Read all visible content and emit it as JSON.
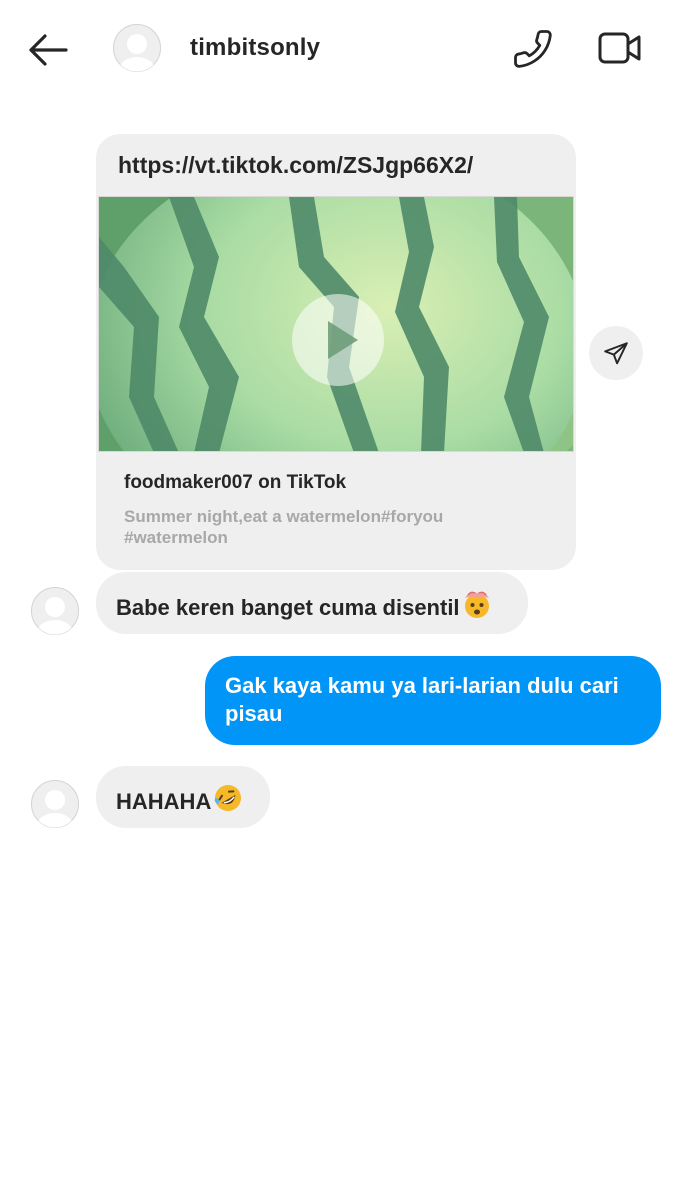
{
  "header": {
    "username": "timbitsonly",
    "icons": {
      "back": "arrow-left-icon",
      "call": "phone-icon",
      "video": "video-camera-icon"
    }
  },
  "share": {
    "url": "https://vt.tiktok.com/ZSJgp66X2/",
    "title": "foodmaker007 on TikTok",
    "description": "Summer night,eat a watermelon#foryou #watermelon",
    "thumbnail": "watermelon-video-thumbnail",
    "icon": "play-icon"
  },
  "messages": [
    {
      "from": "them",
      "text": "Babe keren banget cuma disentil",
      "emoji": "exploding-head-emoji"
    },
    {
      "from": "me",
      "text": "Gak kaya kamu ya lari-larian dulu cari pisau"
    },
    {
      "from": "them",
      "text": "HAHAHA",
      "emoji": "rolling-on-floor-laughing-emoji"
    }
  ],
  "colors": {
    "incoming_bubble": "#efefef",
    "outgoing_bubble": "#0095f6",
    "text": "#262626",
    "muted_text": "#a8a8a8"
  }
}
